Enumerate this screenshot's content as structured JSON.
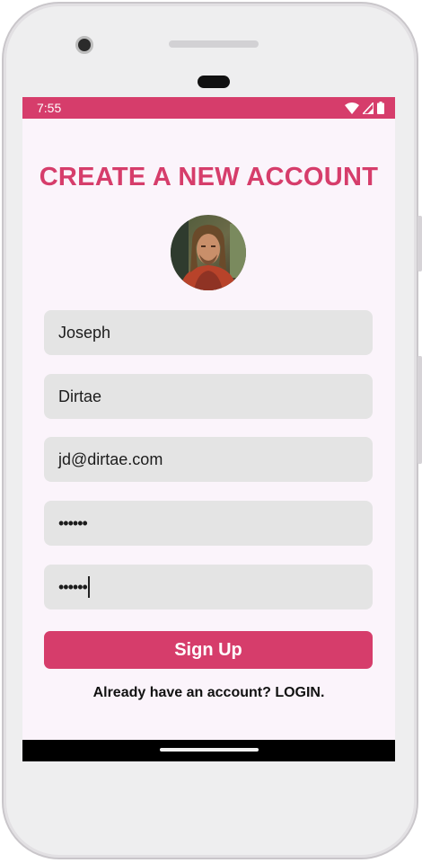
{
  "status_bar": {
    "time": "7:55",
    "icons": [
      "wifi-icon",
      "signal-icon",
      "battery-icon"
    ]
  },
  "page": {
    "title": "CREATE A NEW ACCOUNT",
    "avatar": "profile-photo"
  },
  "form": {
    "first_name": "Joseph",
    "last_name": "Dirtae",
    "email": "jd@dirtae.com",
    "password": "••••••",
    "confirm_password": "••••••"
  },
  "actions": {
    "signup_label": "Sign Up",
    "login_prompt": "Already have an account? LOGIN."
  },
  "colors": {
    "accent": "#d63d6b",
    "screen_bg": "#fbf4fb",
    "field_bg": "#e4e4e4"
  }
}
